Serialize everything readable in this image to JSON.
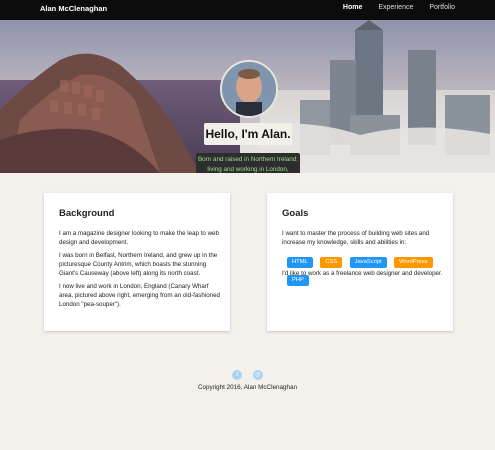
{
  "nav": {
    "brand": "Alan McClenaghan",
    "links": [
      {
        "label": "Home",
        "active": true
      },
      {
        "label": "Experience",
        "active": false
      },
      {
        "label": "Portfolio",
        "active": false
      }
    ]
  },
  "hero": {
    "greeting": "Hello, I'm Alan.",
    "subtitle_line1": "Born and raised in Northern Ireland;",
    "subtitle_line2": "living and working in London, England."
  },
  "background": {
    "title": "Background",
    "p1": "I am a magazine designer looking to make the leap to web design and development.",
    "p2": "I was born in Belfast, Northern Ireland, and grew up in the picturesque County Antrim, which boasts the stunning Giant's Causeway (above left) along its north coast.",
    "p3": "I now live and work in London, England (Canary Wharf area, pictured above right, emerging from an old-fashioned London \"pea-souper\")."
  },
  "goals": {
    "title": "Goals",
    "p1": "I want to master the process of building web sites and increase my knowledge, skills and abilities in:",
    "tags": [
      {
        "label": "HTML",
        "color": "#2196f3"
      },
      {
        "label": "CSS",
        "color": "#ff9800"
      },
      {
        "label": "JavaScript",
        "color": "#2196f3"
      },
      {
        "label": "WordPress",
        "color": "#ff9800"
      },
      {
        "label": "PHP",
        "color": "#2196f3"
      }
    ],
    "p2": "I'd like to work as a freelance web designer and developer."
  },
  "footer": {
    "social_icons": [
      "twitter-icon",
      "dribbble-icon"
    ],
    "copyright": "Copyright 2016, Alan McClenaghan"
  }
}
